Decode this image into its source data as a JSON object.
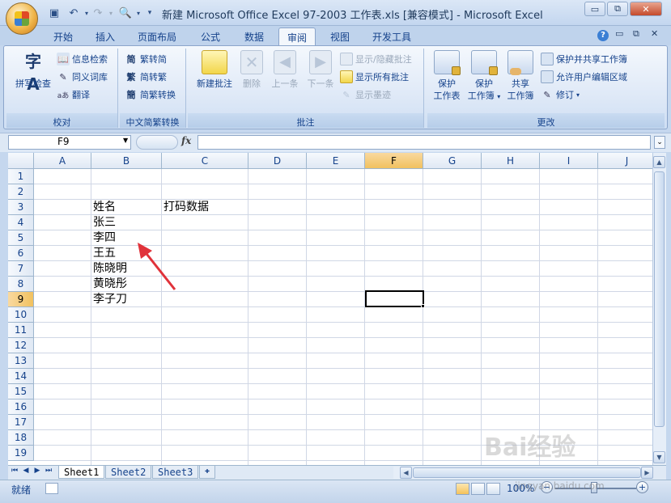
{
  "window": {
    "title": "新建 Microsoft Office Excel 97-2003 工作表.xls  [兼容模式] - Microsoft Excel",
    "minimize_label": "▭",
    "restore_label": "⧉",
    "close_label": "✕"
  },
  "quick_access": [
    "save-icon",
    "undo-icon",
    "redo-icon",
    "print-preview-icon",
    "customize-dropdown-icon"
  ],
  "ribbon": {
    "tabs": [
      "开始",
      "插入",
      "页面布局",
      "公式",
      "数据",
      "审阅",
      "视图",
      "开发工具"
    ],
    "active_tab": "审阅",
    "groups": {
      "proofing": {
        "label": "校对",
        "spellcheck": "拼写检查",
        "research": "信息检索",
        "thesaurus": "同义词库",
        "translate": "翻译"
      },
      "chinese": {
        "label": "中文简繁转换",
        "to_traditional": "繁转简",
        "to_simplified": "简转繁",
        "convert": "简繁转换"
      },
      "comments": {
        "label": "批注",
        "new_comment": "新建批注",
        "delete": "删除",
        "previous": "上一条",
        "next": "下一条",
        "show_hide": "显示/隐藏批注",
        "show_all": "显示所有批注",
        "show_ink": "显示墨迹"
      },
      "changes": {
        "label": "更改",
        "protect_sheet_1": "保护",
        "protect_sheet_2": "工作表",
        "protect_workbook_1": "保护",
        "protect_workbook_2": "工作簿",
        "share_workbook_1": "共享",
        "share_workbook_2": "工作簿",
        "protect_share": "保护并共享工作簿",
        "allow_edit_ranges": "允许用户编辑区域",
        "track_changes": "修订"
      }
    }
  },
  "formula_bar": {
    "name_box": "F9",
    "fx": "fx",
    "formula": ""
  },
  "grid": {
    "columns": [
      "A",
      "B",
      "C",
      "D",
      "E",
      "F",
      "G",
      "H",
      "I",
      "J"
    ],
    "rows": [
      "1",
      "2",
      "3",
      "4",
      "5",
      "6",
      "7",
      "8",
      "9",
      "10",
      "11",
      "12",
      "13",
      "14",
      "15",
      "16",
      "17",
      "18",
      "19"
    ],
    "selected_cell": "F9",
    "cells": {
      "B3": "姓名",
      "C3": "打码数据",
      "B4": "张三",
      "B5": "李四",
      "B6": "王五",
      "B7": "陈晓明",
      "B8": "黄晓彤",
      "B9": "李子刀"
    },
    "annotation_arrow_color": "#e0323a"
  },
  "sheets": {
    "tabs": [
      "Sheet1",
      "Sheet2",
      "Sheet3"
    ],
    "active": "Sheet1"
  },
  "status": {
    "text": "就绪",
    "zoom": "100%",
    "zoom_minus": "−",
    "zoom_plus": "+"
  },
  "watermark": {
    "brand": "Bai经验",
    "url": "jingyan.baidu.com"
  }
}
